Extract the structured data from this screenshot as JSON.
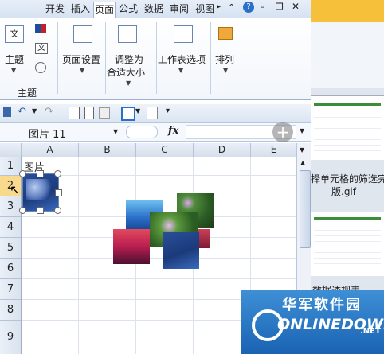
{
  "tabs": [
    {
      "label": "开发",
      "active": false
    },
    {
      "label": "插入",
      "active": false
    },
    {
      "label": "页面",
      "active": true
    },
    {
      "label": "公式",
      "active": false
    },
    {
      "label": "数据",
      "active": false
    },
    {
      "label": "审阅",
      "active": false
    },
    {
      "label": "视图",
      "active": false
    }
  ],
  "ribbon": {
    "theme_label": "主题",
    "theme_group_label": "主题",
    "page_setup_label": "页面设置",
    "fit_label_1": "调整为",
    "fit_label_2": "合适大小",
    "sheet_options_label": "工作表选项",
    "arrange_label": "排列"
  },
  "formula_bar": {
    "name_box": "图片 11",
    "fx": "fx"
  },
  "grid": {
    "columns": [
      "A",
      "B",
      "C",
      "D",
      "E"
    ],
    "rows": [
      "1",
      "2",
      "3",
      "4",
      "5",
      "6",
      "7",
      "8",
      "9"
    ],
    "cell_A1": "图片"
  },
  "side_panel": {
    "caption_1": "择单元格的筛选完",
    "caption_2": "版.gif",
    "caption_3": "数据透视表"
  },
  "watermark": {
    "brand_cn": "华军软件园",
    "brand_en": "ONLINEDOWN",
    "suffix": ".NET"
  }
}
